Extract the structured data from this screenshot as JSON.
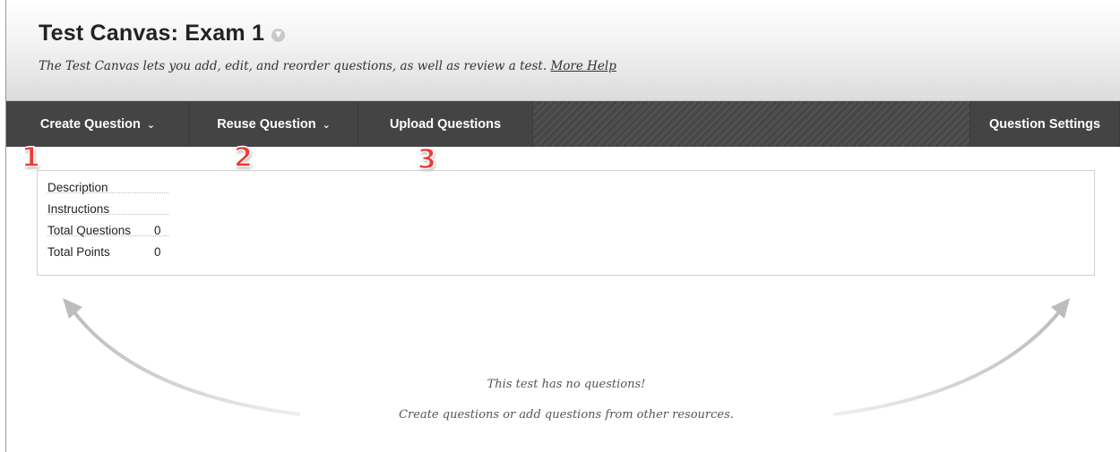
{
  "header": {
    "title": "Test Canvas: Exam 1",
    "subtitle": "The Test Canvas lets you add, edit, and reorder questions, as well as review a test.",
    "help_link": "More Help"
  },
  "action_bar": {
    "create_question": "Create Question",
    "reuse_question": "Reuse Question",
    "upload_questions": "Upload Questions",
    "question_settings": "Question Settings"
  },
  "annotations": [
    "1",
    "2",
    "3"
  ],
  "info": {
    "rows": [
      {
        "label": "Description",
        "value": ""
      },
      {
        "label": "Instructions",
        "value": ""
      },
      {
        "label": "Total Questions",
        "value": "0"
      },
      {
        "label": "Total Points",
        "value": "0"
      }
    ]
  },
  "empty_state": {
    "line1": "This test has no questions!",
    "line2": "Create questions or add questions from other resources."
  },
  "colors": {
    "action_bar": "#444444",
    "annotation": "#ec3b36"
  },
  "icons": {
    "title_menu": "chevron-down-circle-icon",
    "dropdown": "chevron-down-icon"
  }
}
